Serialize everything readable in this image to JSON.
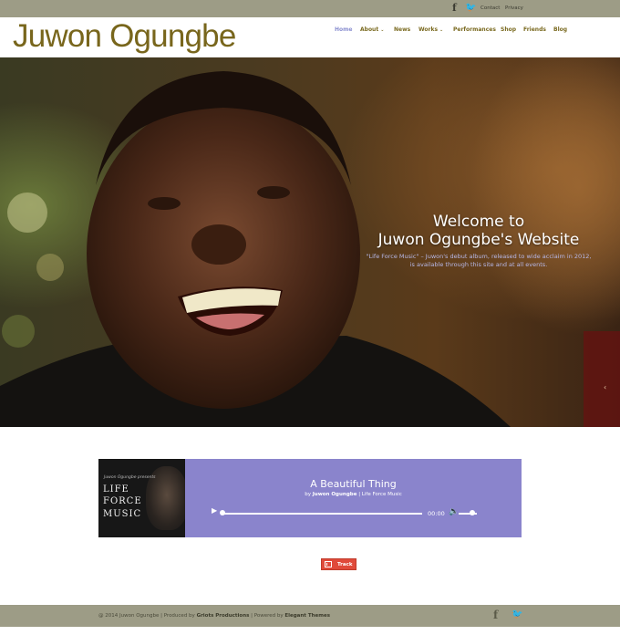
{
  "topbar": {
    "facebook_icon": "facebook-icon",
    "twitter_icon": "twitter-icon",
    "links": [
      "Contact",
      "Privacy"
    ]
  },
  "header": {
    "logo": "Juwon Ogungbe",
    "nav": [
      {
        "label": "Home",
        "active": true
      },
      {
        "label": "About",
        "dropdown": true
      },
      {
        "label": "News"
      },
      {
        "label": "Works",
        "dropdown": true
      },
      {
        "label": "Performances"
      },
      {
        "label": "Shop"
      },
      {
        "label": "Friends"
      },
      {
        "label": "Blog"
      }
    ]
  },
  "hero": {
    "title_line1": "Welcome to",
    "title_line2": "Juwon Ogungbe's Website",
    "subtitle": "\"Life Force Music\" – Juwon's debut album, released to wide acclaim in 2012, is available through this site and at all events."
  },
  "player": {
    "album": {
      "small": "Juwon Ogungbe presents",
      "line1": "LIFE",
      "line2": "FORCE",
      "line3": "MUSIC"
    },
    "track_title": "A Beautiful Thing",
    "by_prefix": "by",
    "artist": "Juwon Ogungbe",
    "separator": "|",
    "album_name": "Life Force Music",
    "time": "00:00",
    "progress_fraction": 0.0
  },
  "track_button": {
    "label": "Track"
  },
  "footer": {
    "copy_prefix": "@ 2014 Juwon Ogungbe | Produced by ",
    "producer": "Griots Productions",
    "copy_mid": " | Powered by ",
    "powered": "Elegant Themes"
  },
  "colors": {
    "topbar_bg": "#9d9c86",
    "logo": "#78661c",
    "nav_active": "#8a8fd0",
    "player_bg": "#8a84cc",
    "track_button": "#e04a3a"
  }
}
